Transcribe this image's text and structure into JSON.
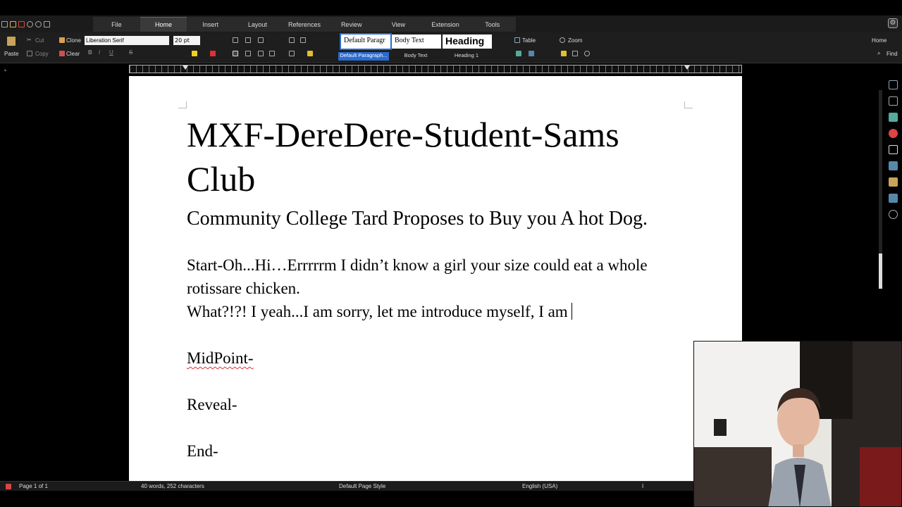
{
  "menu": {
    "tabs": [
      "File",
      "Home",
      "Insert",
      "Layout",
      "References",
      "Review",
      "View",
      "Extension",
      "Tools"
    ],
    "active_tab": "Home"
  },
  "ribbon": {
    "paste": "Paste",
    "cut": "Cut",
    "copy": "Copy",
    "clone": "Clone",
    "clear": "Clear",
    "font_name": "Liberation Serif",
    "font_size": "20 pt",
    "styles": [
      {
        "preview": "Default Paragr",
        "label": "Default Paragraph..."
      },
      {
        "preview": "Body Text",
        "label": "Body Text"
      },
      {
        "preview": "Heading",
        "label": "Heading 1"
      }
    ],
    "table": "Table",
    "zoom": "Zoom",
    "home": "Home",
    "find": "Find"
  },
  "document": {
    "title": "MXF-DereDere-Student-Sams Club",
    "subtitle": "Community College Tard Proposes to Buy you A hot Dog.",
    "start_line1": "Start-Oh...Hi…Errrrrm I didn’t know a girl your size could eat a whole rotissare chicken.",
    "start_line2": "What?!?! I yeah...I am sorry, let me introduce myself, I am ",
    "midpoint": "MidPoint-",
    "reveal": "Reveal-",
    "end": "End-"
  },
  "status": {
    "page": "Page 1 of 1",
    "words": "40 words, 252 characters",
    "page_style": "Default Page Style",
    "language": "English (USA)"
  },
  "colors": {
    "accent": "#2a6bd1",
    "spell_underline": "#e03030"
  }
}
